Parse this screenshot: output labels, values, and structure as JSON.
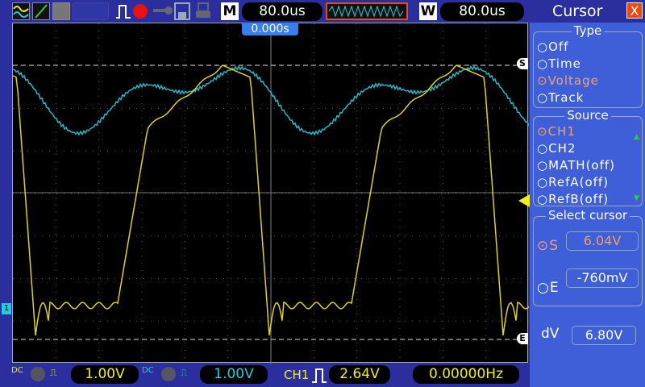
{
  "toolbar": {
    "timebase_label": "M",
    "timebase": "80.0us",
    "window_label": "W",
    "window": "80.0us",
    "trigger_position": "0.000s",
    "icons": [
      "channel-waves-icon",
      "math-line-icon",
      "refs-icon",
      "trigger-edge-icon",
      "record-icon",
      "key-icon",
      "save-icon",
      "print-icon"
    ]
  },
  "markers": {
    "start": "S",
    "end": "E",
    "ch1": "1"
  },
  "panel": {
    "title": "Cursor",
    "close": "X",
    "type_label": "Type",
    "types": [
      "Off",
      "Time",
      "Voltage",
      "Track"
    ],
    "type_selected": 2,
    "source_label": "Source",
    "sources": [
      "CH1",
      "CH2",
      "MATH(off)",
      "RefA(off)",
      "RefB(off)"
    ],
    "source_selected": 0,
    "select_label": "Select cursor",
    "s_label": "S",
    "s_value": "6.04V",
    "e_label": "E",
    "e_value": "-760mV",
    "dv_label": "dV",
    "dv_value": "6.80V"
  },
  "bottom": {
    "ch1_coupling": "DC",
    "ch1_scale": "1.00V",
    "ch2_coupling": "DC",
    "ch2_scale": "1.00V",
    "trig_source": "CH1",
    "trig_level": "2.64V",
    "frequency": "0.00000Hz"
  },
  "colors": {
    "ch1": "#e0d020",
    "ch2": "#20b8c8",
    "accent": "#e84a10"
  }
}
